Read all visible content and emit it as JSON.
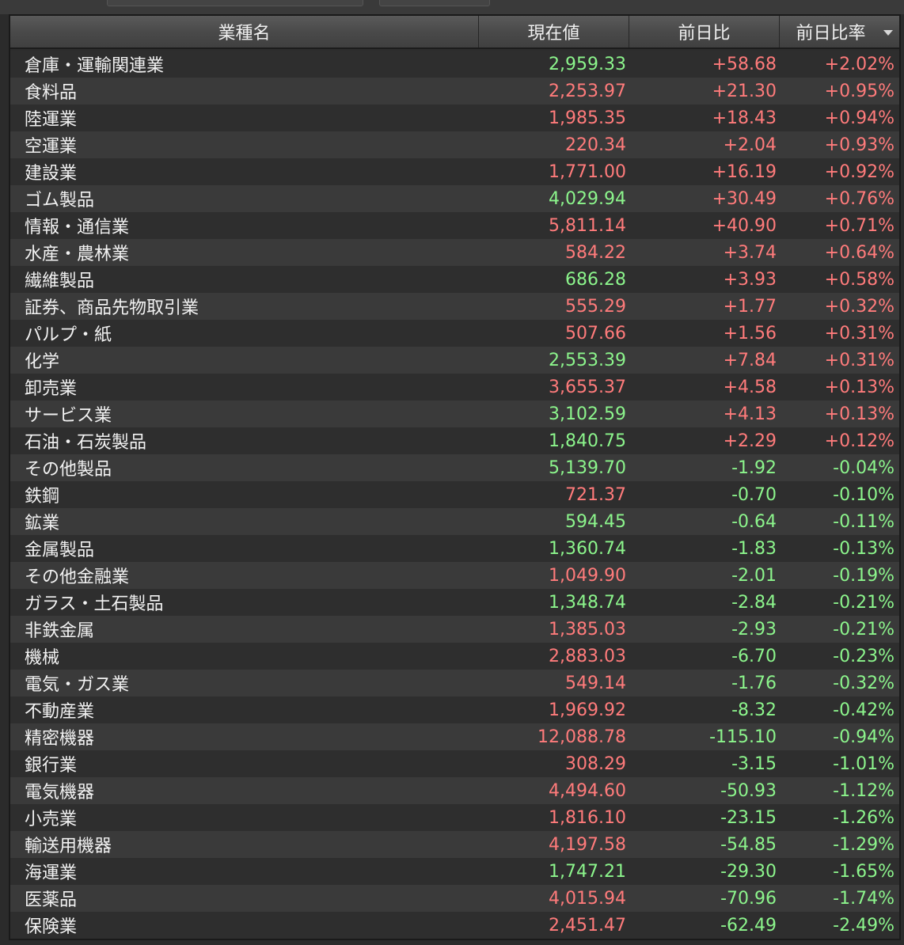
{
  "colors": {
    "up": "#ff7b7b",
    "down": "#8cf58c",
    "text": "#f2f2f2"
  },
  "header": {
    "name": "業種名",
    "price": "現在値",
    "change": "前日比",
    "change_pct": "前日比率",
    "sort_icon": "sort-descending-icon"
  },
  "rows": [
    {
      "name": "倉庫・運輸関連業",
      "price": "2,959.33",
      "price_color": "#8cf58c",
      "change": "+58.68",
      "change_pct": "+2.02%"
    },
    {
      "name": "食料品",
      "price": "2,253.97",
      "price_color": "#ff7b7b",
      "change": "+21.30",
      "change_pct": "+0.95%"
    },
    {
      "name": "陸運業",
      "price": "1,985.35",
      "price_color": "#ff7b7b",
      "change": "+18.43",
      "change_pct": "+0.94%"
    },
    {
      "name": "空運業",
      "price": "220.34",
      "price_color": "#ff7b7b",
      "change": "+2.04",
      "change_pct": "+0.93%"
    },
    {
      "name": "建設業",
      "price": "1,771.00",
      "price_color": "#ff7b7b",
      "change": "+16.19",
      "change_pct": "+0.92%"
    },
    {
      "name": "ゴム製品",
      "price": "4,029.94",
      "price_color": "#8cf58c",
      "change": "+30.49",
      "change_pct": "+0.76%"
    },
    {
      "name": "情報・通信業",
      "price": "5,811.14",
      "price_color": "#ff7b7b",
      "change": "+40.90",
      "change_pct": "+0.71%"
    },
    {
      "name": "水産・農林業",
      "price": "584.22",
      "price_color": "#ff7b7b",
      "change": "+3.74",
      "change_pct": "+0.64%"
    },
    {
      "name": "繊維製品",
      "price": "686.28",
      "price_color": "#8cf58c",
      "change": "+3.93",
      "change_pct": "+0.58%"
    },
    {
      "name": "証券、商品先物取引業",
      "price": "555.29",
      "price_color": "#ff7b7b",
      "change": "+1.77",
      "change_pct": "+0.32%"
    },
    {
      "name": "パルプ・紙",
      "price": "507.66",
      "price_color": "#ff7b7b",
      "change": "+1.56",
      "change_pct": "+0.31%"
    },
    {
      "name": "化学",
      "price": "2,553.39",
      "price_color": "#8cf58c",
      "change": "+7.84",
      "change_pct": "+0.31%"
    },
    {
      "name": "卸売業",
      "price": "3,655.37",
      "price_color": "#ff7b7b",
      "change": "+4.58",
      "change_pct": "+0.13%"
    },
    {
      "name": "サービス業",
      "price": "3,102.59",
      "price_color": "#8cf58c",
      "change": "+4.13",
      "change_pct": "+0.13%"
    },
    {
      "name": "石油・石炭製品",
      "price": "1,840.75",
      "price_color": "#8cf58c",
      "change": "+2.29",
      "change_pct": "+0.12%"
    },
    {
      "name": "その他製品",
      "price": "5,139.70",
      "price_color": "#8cf58c",
      "change": "-1.92",
      "change_pct": "-0.04%"
    },
    {
      "name": "鉄鋼",
      "price": "721.37",
      "price_color": "#ff7b7b",
      "change": "-0.70",
      "change_pct": "-0.10%"
    },
    {
      "name": "鉱業",
      "price": "594.45",
      "price_color": "#8cf58c",
      "change": "-0.64",
      "change_pct": "-0.11%"
    },
    {
      "name": "金属製品",
      "price": "1,360.74",
      "price_color": "#8cf58c",
      "change": "-1.83",
      "change_pct": "-0.13%"
    },
    {
      "name": "その他金融業",
      "price": "1,049.90",
      "price_color": "#ff7b7b",
      "change": "-2.01",
      "change_pct": "-0.19%"
    },
    {
      "name": "ガラス・土石製品",
      "price": "1,348.74",
      "price_color": "#8cf58c",
      "change": "-2.84",
      "change_pct": "-0.21%"
    },
    {
      "name": "非鉄金属",
      "price": "1,385.03",
      "price_color": "#ff7b7b",
      "change": "-2.93",
      "change_pct": "-0.21%"
    },
    {
      "name": "機械",
      "price": "2,883.03",
      "price_color": "#ff7b7b",
      "change": "-6.70",
      "change_pct": "-0.23%"
    },
    {
      "name": "電気・ガス業",
      "price": "549.14",
      "price_color": "#ff7b7b",
      "change": "-1.76",
      "change_pct": "-0.32%"
    },
    {
      "name": "不動産業",
      "price": "1,969.92",
      "price_color": "#ff7b7b",
      "change": "-8.32",
      "change_pct": "-0.42%"
    },
    {
      "name": "精密機器",
      "price": "12,088.78",
      "price_color": "#ff7b7b",
      "change": "-115.10",
      "change_pct": "-0.94%"
    },
    {
      "name": "銀行業",
      "price": "308.29",
      "price_color": "#ff7b7b",
      "change": "-3.15",
      "change_pct": "-1.01%"
    },
    {
      "name": "電気機器",
      "price": "4,494.60",
      "price_color": "#ff7b7b",
      "change": "-50.93",
      "change_pct": "-1.12%"
    },
    {
      "name": "小売業",
      "price": "1,816.10",
      "price_color": "#ff7b7b",
      "change": "-23.15",
      "change_pct": "-1.26%"
    },
    {
      "name": "輸送用機器",
      "price": "4,197.58",
      "price_color": "#ff7b7b",
      "change": "-54.85",
      "change_pct": "-1.29%"
    },
    {
      "name": "海運業",
      "price": "1,747.21",
      "price_color": "#8cf58c",
      "change": "-29.30",
      "change_pct": "-1.65%"
    },
    {
      "name": "医薬品",
      "price": "4,015.94",
      "price_color": "#ff7b7b",
      "change": "-70.96",
      "change_pct": "-1.74%"
    },
    {
      "name": "保険業",
      "price": "2,451.47",
      "price_color": "#ff7b7b",
      "change": "-62.49",
      "change_pct": "-2.49%"
    }
  ]
}
